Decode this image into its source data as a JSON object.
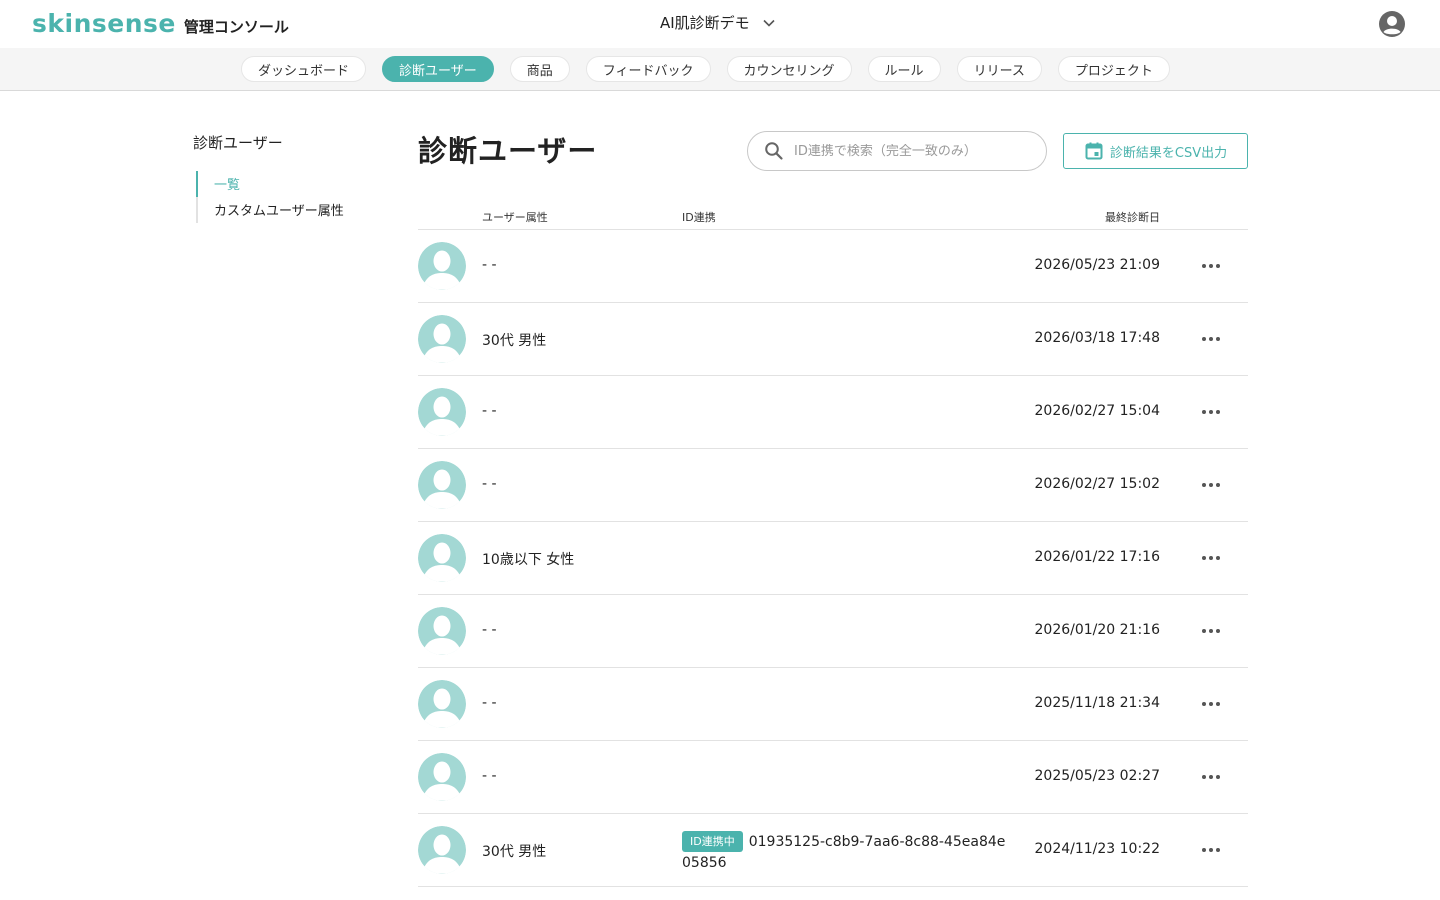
{
  "header": {
    "logo_text": "skinsense",
    "console_label": "管理コンソール",
    "project_name": "AI肌診断デモ"
  },
  "nav": {
    "tabs": [
      {
        "label": "ダッシュボード",
        "active": false
      },
      {
        "label": "診断ユーザー",
        "active": true
      },
      {
        "label": "商品",
        "active": false
      },
      {
        "label": "フィードバック",
        "active": false
      },
      {
        "label": "カウンセリング",
        "active": false
      },
      {
        "label": "ルール",
        "active": false
      },
      {
        "label": "リリース",
        "active": false
      },
      {
        "label": "プロジェクト",
        "active": false
      }
    ]
  },
  "sidebar": {
    "title": "診断ユーザー",
    "items": [
      {
        "label": "一覧",
        "active": true
      },
      {
        "label": "カスタムユーザー属性",
        "active": false
      }
    ]
  },
  "main": {
    "title": "診断ユーザー",
    "search_placeholder": "ID連携で検索（完全一致のみ）",
    "csv_button": "診断結果をCSV出力",
    "columns": {
      "attributes": "ユーザー属性",
      "id_link": "ID連携",
      "last_diagnosis": "最終診断日"
    },
    "rows": [
      {
        "attributes": "- -",
        "badge": "",
        "id_value": "",
        "date": "2026/05/23 21:09"
      },
      {
        "attributes": "30代 男性",
        "badge": "",
        "id_value": "",
        "date": "2026/03/18 17:48"
      },
      {
        "attributes": "- -",
        "badge": "",
        "id_value": "",
        "date": "2026/02/27 15:04"
      },
      {
        "attributes": "- -",
        "badge": "",
        "id_value": "",
        "date": "2026/02/27 15:02"
      },
      {
        "attributes": "10歳以下 女性",
        "badge": "",
        "id_value": "",
        "date": "2026/01/22 17:16"
      },
      {
        "attributes": "- -",
        "badge": "",
        "id_value": "",
        "date": "2026/01/20 21:16"
      },
      {
        "attributes": "- -",
        "badge": "",
        "id_value": "",
        "date": "2025/11/18 21:34"
      },
      {
        "attributes": "- -",
        "badge": "",
        "id_value": "",
        "date": "2025/05/23 02:27"
      },
      {
        "attributes": "30代 男性",
        "badge": "ID連携中",
        "id_value": "01935125-c8b9-7aa6-8c88-45ea84e05856",
        "date": "2024/11/23 10:22"
      }
    ]
  },
  "colors": {
    "accent": "#4bb3ad",
    "avatar": "#a3d8d4"
  }
}
